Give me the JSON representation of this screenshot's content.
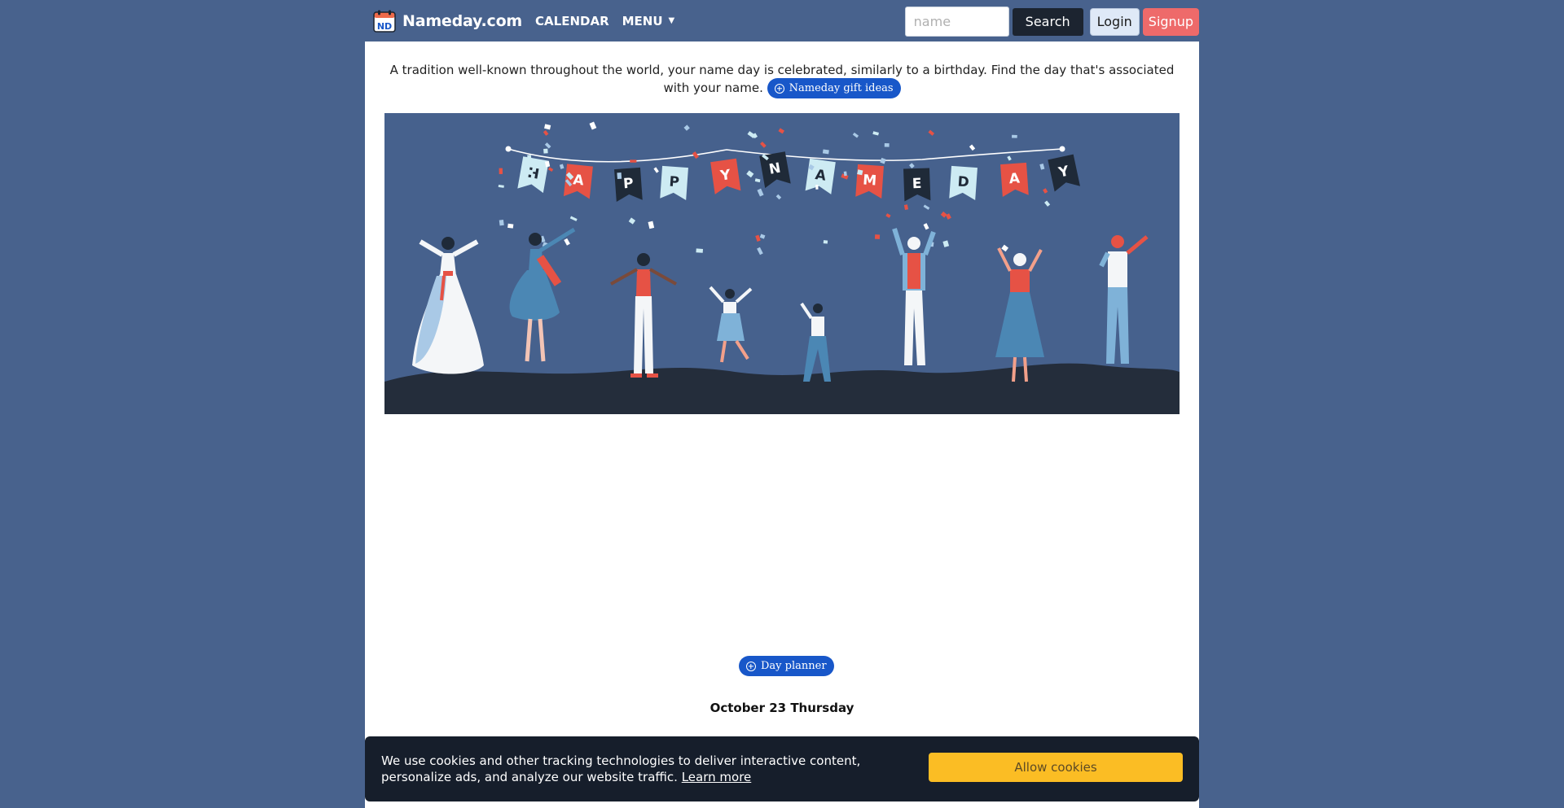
{
  "brand": {
    "name": "Nameday.com",
    "logo_text": "ND",
    "logo_icon": "calendar-logo-icon"
  },
  "nav": {
    "calendar_label": "CALENDAR",
    "menu_label": "MENU",
    "menu_caret": "▼",
    "search_placeholder": "name",
    "search_label": "Search",
    "login_label": "Login",
    "signup_label": "Signup"
  },
  "intro": {
    "text": "A tradition well-known throughout the world, your name day is celebrated, similarly to a birthday. Find the day that's associated with your name.",
    "gift_button_label": "Nameday gift ideas",
    "gift_button_icon": "plus-circle-icon"
  },
  "hero": {
    "banner_letters": [
      "H",
      "A",
      "P",
      "P",
      "Y",
      "N",
      "A",
      "M",
      "E",
      "D",
      "A",
      "Y"
    ],
    "banner_colors": [
      "#cdebf3",
      "#e65245",
      "#1f2a38",
      "#cdebf3",
      "#e65245",
      "#1f2a38",
      "#cdebf3",
      "#e65245",
      "#1f2a38",
      "#cdebf3",
      "#e65245",
      "#1f2a38"
    ],
    "background_color": "#46618d",
    "ground_color": "#242d3b"
  },
  "planner": {
    "label": "Day planner",
    "icon": "plus-circle-icon"
  },
  "date": {
    "text": "October 23 Thursday"
  },
  "cookie": {
    "text": "We use cookies and other tracking technologies to deliver interactive content, personalize ads, and analyze our website traffic.",
    "learn_more": "Learn more",
    "allow_label": "Allow cookies"
  },
  "colors": {
    "page_bg": "#48628d",
    "accent_blue": "#1857c9",
    "signup_red": "#ee6a6a",
    "cookie_yellow": "#fbbd24",
    "dark": "#161e2b"
  }
}
